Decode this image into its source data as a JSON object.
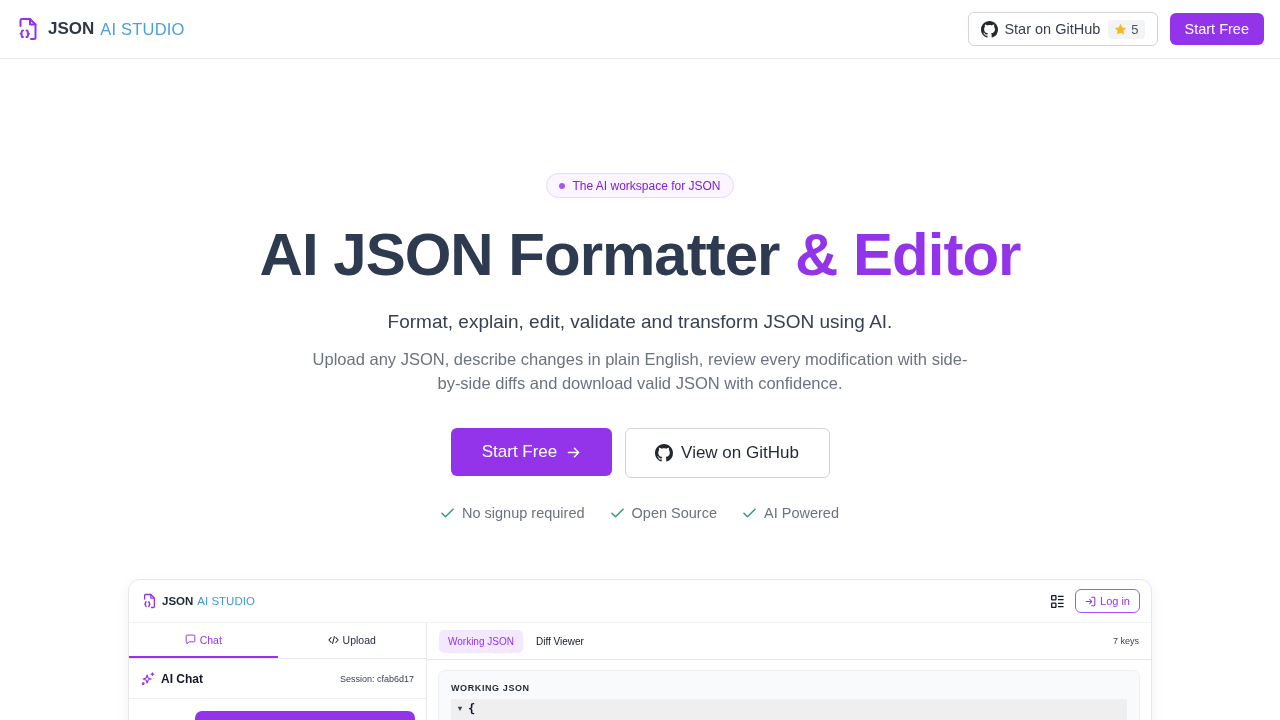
{
  "header": {
    "logo": {
      "primary": "JSON",
      "secondary": "AI STUDIO"
    },
    "github_button": {
      "label": "Star on GitHub",
      "star_count": "5"
    },
    "cta_button": "Start Free"
  },
  "hero": {
    "badge": "The AI workspace for JSON",
    "title": {
      "text": "AI JSON Formatter",
      "highlight": "& Editor"
    },
    "subtitle": "Format, explain, edit, validate and transform JSON using AI.",
    "description": "Upload any JSON, describe changes in plain English, review every modification with side-by-side diffs and download valid JSON with confidence.",
    "primary_button": "Start Free",
    "secondary_button": "View on GitHub",
    "features": [
      "No signup required",
      "Open Source",
      "AI Powered"
    ]
  },
  "preview": {
    "logo": {
      "primary": "JSON",
      "secondary": "AI STUDIO"
    },
    "login_button": "Log in",
    "left_tabs": [
      {
        "label": "Chat",
        "selected": true
      },
      {
        "label": "Upload",
        "selected": false
      }
    ],
    "chat": {
      "title": "AI Chat",
      "session": "Session: cfab6d17"
    },
    "right_tabs": [
      {
        "label": "Working JSON",
        "selected": true
      },
      {
        "label": "Diff Viewer",
        "selected": false
      }
    ],
    "key_count": "7 keys",
    "json_panel": {
      "title": "WORKING JSON",
      "tree": [
        {
          "text": "{",
          "expanded": true
        }
      ]
    }
  }
}
